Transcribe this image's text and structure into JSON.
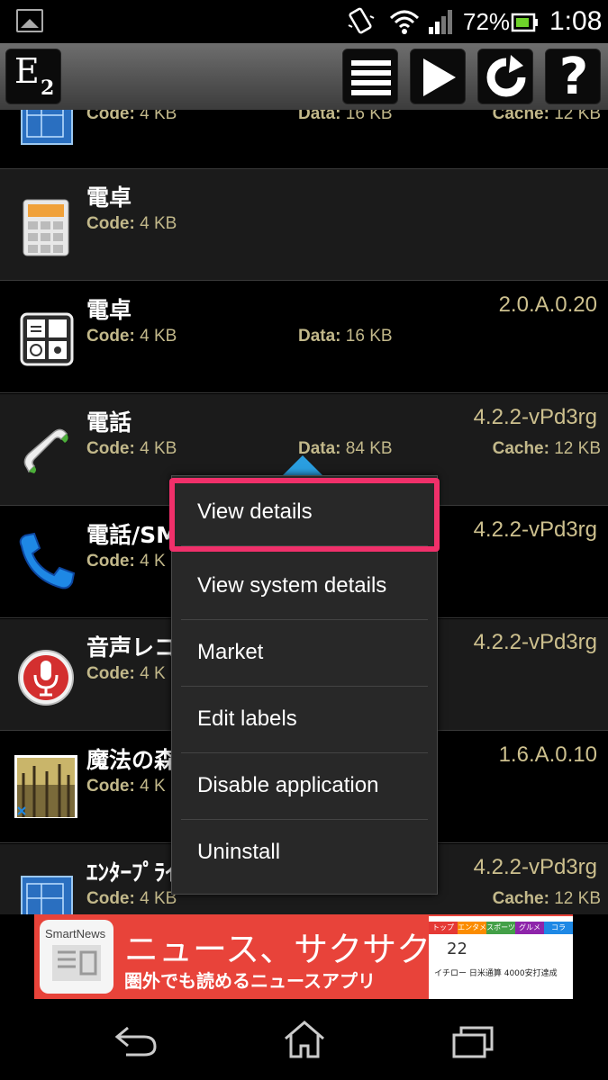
{
  "status_bar": {
    "battery_percent": "72%",
    "time": "1:08",
    "icons": [
      "gallery-icon",
      "vibrate-icon",
      "wifi-icon",
      "signal-icon",
      "battery-icon"
    ]
  },
  "toolbar": {
    "logo_letter": "E",
    "logo_sub": "2",
    "buttons": [
      "list-icon",
      "play-icon",
      "refresh-icon",
      "help-icon"
    ],
    "help_label": "?"
  },
  "labels": {
    "code": "Code:",
    "data": "Data:",
    "cache": "Cache:"
  },
  "apps": [
    {
      "name": "",
      "version": "",
      "code": "4 KB",
      "data": "16 KB",
      "cache": "12 KB",
      "icon": "blueprint-icon"
    },
    {
      "name": "電卓",
      "version": "",
      "code": "4 KB",
      "data": "",
      "cache": "",
      "icon": "calculator-icon"
    },
    {
      "name": "電卓",
      "version": "2.0.A.0.20",
      "code": "4 KB",
      "data": "16 KB",
      "cache": "",
      "icon": "calculator-dark-icon"
    },
    {
      "name": "電話",
      "version": "4.2.2-vPd3rg",
      "code": "4 KB",
      "data": "84 KB",
      "cache": "12 KB",
      "icon": "phone-handset-icon"
    },
    {
      "name": "電話/SM",
      "version": "4.2.2-vPd3rg",
      "code": "4 K",
      "data": "",
      "cache": "",
      "icon": "phone-blue-icon"
    },
    {
      "name": "音声レコ",
      "version": "4.2.2-vPd3rg",
      "code": "4 K",
      "data": "",
      "cache": "",
      "icon": "microphone-icon"
    },
    {
      "name": "魔法の森",
      "version": "1.6.A.0.10",
      "code": "4 K",
      "data": "",
      "cache": "",
      "icon": "forest-icon"
    },
    {
      "name": "ｴﾝﾀｰﾌﾟﾗｲ",
      "version": "4.2.2-vPd3rg",
      "code": "4 KB",
      "data": "",
      "cache": "12 KB",
      "icon": "blueprint-icon"
    }
  ],
  "context_menu": {
    "items": [
      "View details",
      "View system details",
      "Market",
      "Edit labels",
      "Disable application",
      "Uninstall"
    ],
    "highlighted": "View details"
  },
  "ad": {
    "logo": "SmartNews",
    "title": "ニュース、サクサク。",
    "subtitle": "圏外でも読めるニュースアプリ",
    "tabs": [
      "トップ",
      "エンタメ",
      "スポーツ",
      "グルメ",
      "コラ"
    ],
    "phone_date": "22",
    "phone_headline": "イチロー 日米通算 4000安打達成"
  },
  "colors": {
    "meta_text": "#c2b88a",
    "version_text": "#cdc08e",
    "highlight": "#f0306a",
    "menu_arrow": "#2a9ee0",
    "ad_background": "#e8433a"
  }
}
